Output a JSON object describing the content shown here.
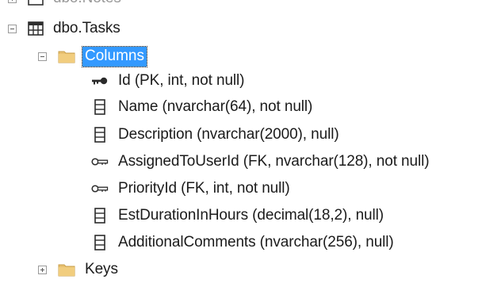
{
  "tree": {
    "partial_top_label": "dbo.Notes",
    "table": {
      "label": "dbo.Tasks",
      "icon": "table-grid-icon"
    },
    "columns_folder": {
      "label": "Columns",
      "icon": "folder-icon",
      "selected": true
    },
    "columns": [
      {
        "label": "Id (PK, int, not null)",
        "icon": "primary-key-icon"
      },
      {
        "label": "Name (nvarchar(64), not null)",
        "icon": "column-icon"
      },
      {
        "label": "Description (nvarchar(2000), null)",
        "icon": "column-icon"
      },
      {
        "label": "AssignedToUserId (FK, nvarchar(128), not null)",
        "icon": "foreign-key-icon"
      },
      {
        "label": "PriorityId (FK, int, not null)",
        "icon": "foreign-key-icon"
      },
      {
        "label": "EstDurationInHours (decimal(18,2), null)",
        "icon": "column-icon"
      },
      {
        "label": "AdditionalComments (nvarchar(256), null)",
        "icon": "column-icon"
      }
    ],
    "keys_folder": {
      "label": "Keys",
      "icon": "folder-icon",
      "expanded": false
    }
  },
  "colors": {
    "selection": "#3399ff",
    "folder": "#e8c070"
  }
}
